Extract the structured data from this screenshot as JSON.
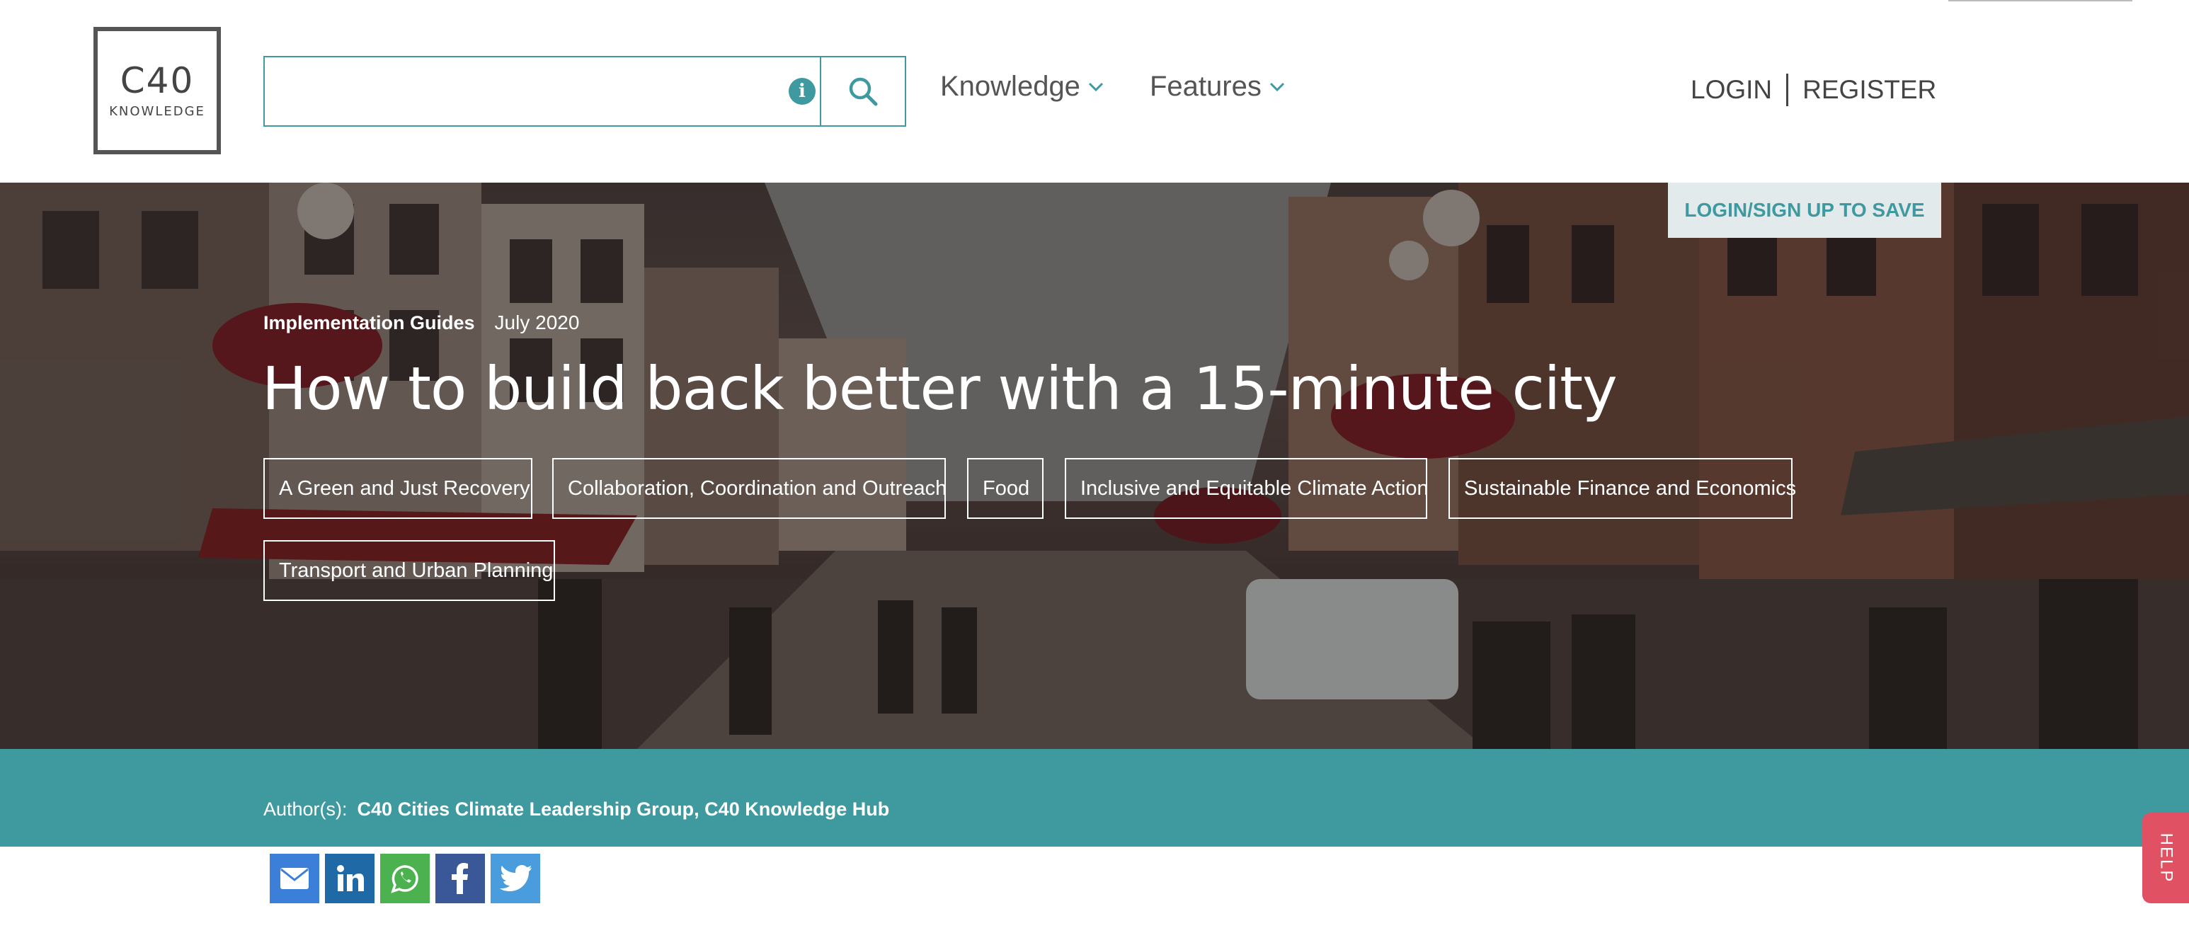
{
  "logo": {
    "main": "C40",
    "sub": "KNOWLEDGE"
  },
  "search": {
    "value": "",
    "placeholder": ""
  },
  "nav": [
    {
      "label": "Knowledge"
    },
    {
      "label": "Features"
    }
  ],
  "auth": {
    "login": "LOGIN",
    "register": "REGISTER"
  },
  "save": {
    "label": "LOGIN/SIGN UP TO SAVE"
  },
  "article": {
    "type": "Implementation Guides",
    "date": "July 2020",
    "title": "How to build back better with a 15-minute city",
    "tags": [
      "A Green and Just Recovery",
      "Collaboration, Coordination and Outreach",
      "Food",
      "Inclusive and Equitable Climate Action",
      "Sustainable Finance and Economics",
      "Transport and Urban Planning"
    ],
    "author_label": "Author(s):",
    "authors": "C40 Cities Climate Leadership Group, C40 Knowledge Hub"
  },
  "share": [
    {
      "icon": "email-icon",
      "color": "#3b7fd9"
    },
    {
      "icon": "linkedin-icon",
      "color": "#1f6aa6"
    },
    {
      "icon": "whatsapp-icon",
      "color": "#4cb14f"
    },
    {
      "icon": "facebook-icon",
      "color": "#3a5897"
    },
    {
      "icon": "twitter-icon",
      "color": "#4a9ddc"
    }
  ],
  "help": {
    "label": "HELP"
  },
  "colors": {
    "accent": "#3f9aa0",
    "help": "#e05263",
    "save_bg": "#e3eaec"
  }
}
